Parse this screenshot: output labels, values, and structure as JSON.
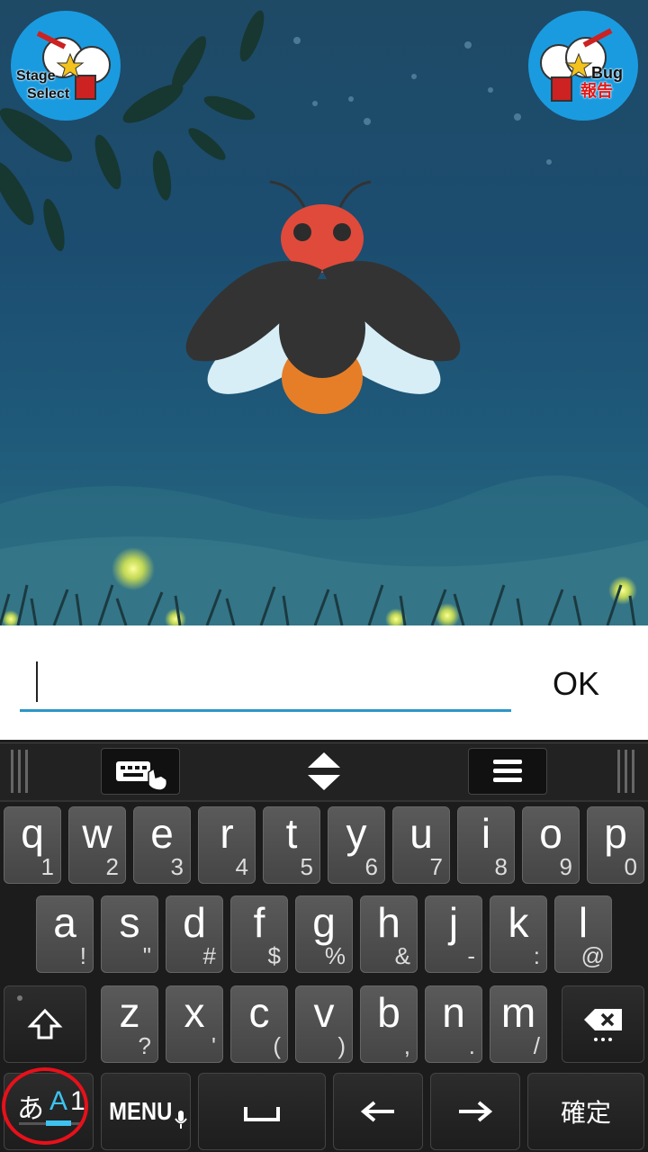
{
  "stage_select": {
    "line1": "Stage",
    "line2": "Select"
  },
  "bug_report": {
    "line1": "Bug",
    "line2": "報告"
  },
  "input": {
    "value": "",
    "ok_label": "OK"
  },
  "keyboard": {
    "row1": [
      {
        "main": "q",
        "sub": "1"
      },
      {
        "main": "w",
        "sub": "2"
      },
      {
        "main": "e",
        "sub": "3"
      },
      {
        "main": "r",
        "sub": "4"
      },
      {
        "main": "t",
        "sub": "5"
      },
      {
        "main": "y",
        "sub": "6"
      },
      {
        "main": "u",
        "sub": "7"
      },
      {
        "main": "i",
        "sub": "8"
      },
      {
        "main": "o",
        "sub": "9"
      },
      {
        "main": "p",
        "sub": "0"
      }
    ],
    "row2": [
      {
        "main": "a",
        "sub": "!"
      },
      {
        "main": "s",
        "sub": "\""
      },
      {
        "main": "d",
        "sub": "#"
      },
      {
        "main": "f",
        "sub": "$"
      },
      {
        "main": "g",
        "sub": "%"
      },
      {
        "main": "h",
        "sub": "&"
      },
      {
        "main": "j",
        "sub": "-"
      },
      {
        "main": "k",
        "sub": ":"
      },
      {
        "main": "l",
        "sub": "@"
      }
    ],
    "row3": [
      {
        "main": "z",
        "sub": "?"
      },
      {
        "main": "x",
        "sub": "'"
      },
      {
        "main": "c",
        "sub": "("
      },
      {
        "main": "v",
        "sub": ")"
      },
      {
        "main": "b",
        "sub": ","
      },
      {
        "main": "n",
        "sub": "."
      },
      {
        "main": "m",
        "sub": "/"
      }
    ],
    "mode_label_kana": "あ",
    "mode_label_alpha": "A",
    "mode_label_num": "1",
    "menu_label": "MENU",
    "confirm_label": "確定",
    "shift_icon": "shift-icon",
    "backspace_icon": "backspace-icon",
    "accent_color": "#2b97c6"
  }
}
